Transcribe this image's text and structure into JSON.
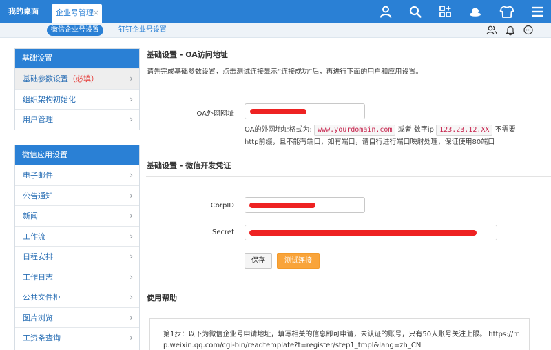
{
  "topbar": {
    "home_label": "我的桌面",
    "active_tab_label": "企业号管理",
    "close_glyph": "×",
    "icons": [
      "user-icon",
      "search-icon",
      "apps-grid-icon",
      "hat-icon",
      "shirt-icon",
      "menu-icon"
    ]
  },
  "subnav": {
    "active": "微信企业号设置",
    "other": "钉钉企业号设置",
    "icons": [
      "users-icon",
      "bell-icon",
      "chat-icon"
    ]
  },
  "sidebar": {
    "basic": {
      "title": "基础设置",
      "items": [
        {
          "label": "基础参数设置",
          "required": "（必填）"
        },
        {
          "label": "组织架构初始化"
        },
        {
          "label": "用户管理"
        }
      ]
    },
    "wechat": {
      "title": "微信应用设置",
      "items": [
        {
          "label": "电子邮件"
        },
        {
          "label": "公告通知"
        },
        {
          "label": "新闻"
        },
        {
          "label": "工作流"
        },
        {
          "label": "日程安排"
        },
        {
          "label": "工作日志"
        },
        {
          "label": "公共文件柜"
        },
        {
          "label": "图片浏览"
        },
        {
          "label": "工资条查询"
        }
      ]
    },
    "chevron": "›"
  },
  "main": {
    "oa_section": {
      "title": "基础设置 - OA访问地址",
      "desc": "请先完成基础参数设置，点击测试连接显示“连接成功”后，再进行下面的用户和应用设置。",
      "url_label": "OA外网网址",
      "hint_prefix": "OA的外网地址格式为:",
      "hint_example_domain": "www.yourdomain.com",
      "hint_or": "或者 数字ip",
      "hint_example_ip": "123.23.12.XX",
      "hint_suffix": "不需要http前缀，且不能有端口，如有端口，请自行进行端口映射处理，保证使用80端口"
    },
    "cred_section": {
      "title": "基础设置 - 微信开发凭证",
      "corpid_label": "CorpID",
      "secret_label": "Secret"
    },
    "buttons": {
      "save": "保存",
      "test": "测试连接"
    },
    "help_section": {
      "title": "使用帮助",
      "step1": "第1步：以下为微信企业号申请地址，填写相关的信息即可申请，未认证的账号，只有50人账号关注上限。 https://mp.weixin.qq.com/cgi-bin/readtemplate?t=register/step1_tmpl&lang=zh_CN"
    }
  },
  "colors": {
    "brand": "#2a80d5",
    "accent_orange": "#f9a43a",
    "redaction": "#ee2222"
  }
}
